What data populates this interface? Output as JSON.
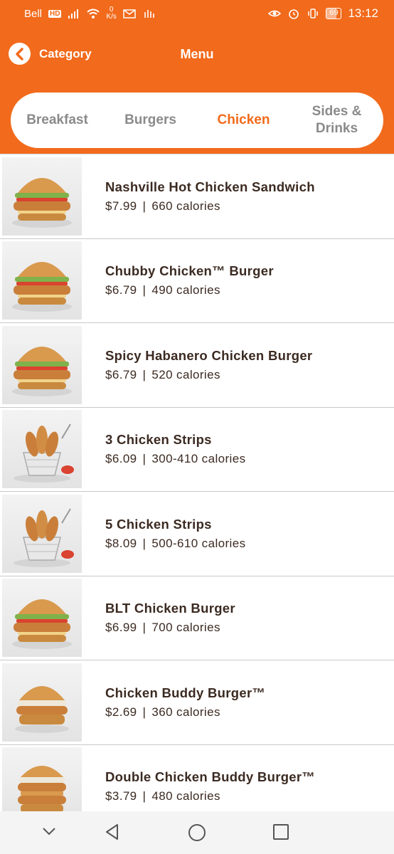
{
  "status_bar": {
    "carrier": "Bell",
    "hd": "HD",
    "speed_value": "0",
    "speed_unit": "K/s",
    "battery": "69",
    "battery_level": 0.69,
    "time": "13:12"
  },
  "header": {
    "back_label": "Category",
    "title": "Menu",
    "accent_color": "#f26a1b"
  },
  "tabs": [
    {
      "label": "Breakfast",
      "active": false
    },
    {
      "label": "Burgers",
      "active": false
    },
    {
      "label": "Chicken",
      "active": true
    },
    {
      "label": "Sides & Drinks",
      "active": false
    }
  ],
  "items": [
    {
      "name": "Nashville Hot Chicken Sandwich",
      "price": "$7.99",
      "calories": "660 calories",
      "image": "chicken-sandwich"
    },
    {
      "name": "Chubby Chicken™ Burger",
      "price": "$6.79",
      "calories": "490 calories",
      "image": "chicken-burger"
    },
    {
      "name": "Spicy Habanero Chicken Burger",
      "price": "$6.79",
      "calories": "520 calories",
      "image": "chicken-burger"
    },
    {
      "name": "3 Chicken Strips",
      "price": "$6.09",
      "calories": "300-410 calories",
      "image": "chicken-strips"
    },
    {
      "name": "5 Chicken Strips",
      "price": "$8.09",
      "calories": "500-610 calories",
      "image": "chicken-strips"
    },
    {
      "name": "BLT Chicken Burger",
      "price": "$6.99",
      "calories": "700 calories",
      "image": "chicken-burger"
    },
    {
      "name": "Chicken Buddy Burger™",
      "price": "$2.69",
      "calories": "360 calories",
      "image": "small-burger"
    },
    {
      "name": "Double Chicken Buddy Burger™",
      "price": "$3.79",
      "calories": "480 calories",
      "image": "double-burger"
    }
  ],
  "nav": {
    "icons": [
      "chevron-down-icon",
      "back-triangle-icon",
      "home-circle-icon",
      "recents-square-icon"
    ]
  }
}
